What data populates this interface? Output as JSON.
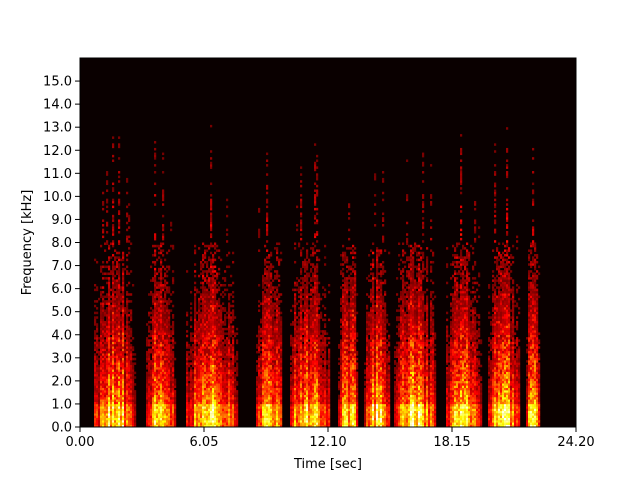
{
  "chart_data": {
    "type": "heatmap",
    "title": "",
    "xlabel": "Time [sec]",
    "ylabel": "Frequency [kHz]",
    "xlim": [
      0,
      24.2
    ],
    "ylim": [
      0,
      16
    ],
    "x_ticks": [
      0.0,
      6.05,
      12.1,
      18.15,
      24.2
    ],
    "x_tick_labels": [
      "0.00",
      "6.05",
      "12.10",
      "18.15",
      "24.20"
    ],
    "y_ticks": [
      0,
      1,
      2,
      3,
      4,
      5,
      6,
      7,
      8,
      9,
      10,
      11,
      12,
      13,
      14,
      15
    ],
    "y_tick_labels": [
      "0.0",
      "1.0",
      "2.0",
      "3.0",
      "4.0",
      "5.0",
      "6.0",
      "7.0",
      "8.0",
      "9.0",
      "10.0",
      "11.0",
      "12.0",
      "13.0",
      "14.0",
      "15.0"
    ],
    "colormap": "hot",
    "background_color": "#0a0000",
    "speech_segments_sec": [
      [
        0.7,
        2.7
      ],
      [
        3.2,
        4.7
      ],
      [
        5.2,
        7.7
      ],
      [
        8.6,
        9.9
      ],
      [
        10.2,
        12.2
      ],
      [
        12.6,
        13.6
      ],
      [
        13.9,
        15.1
      ],
      [
        15.3,
        17.4
      ],
      [
        17.9,
        19.6
      ],
      [
        19.9,
        21.5
      ],
      [
        21.8,
        22.4
      ]
    ],
    "bright_band_kHz": [
      0.0,
      1.0
    ],
    "grid": false,
    "legend": "none"
  }
}
